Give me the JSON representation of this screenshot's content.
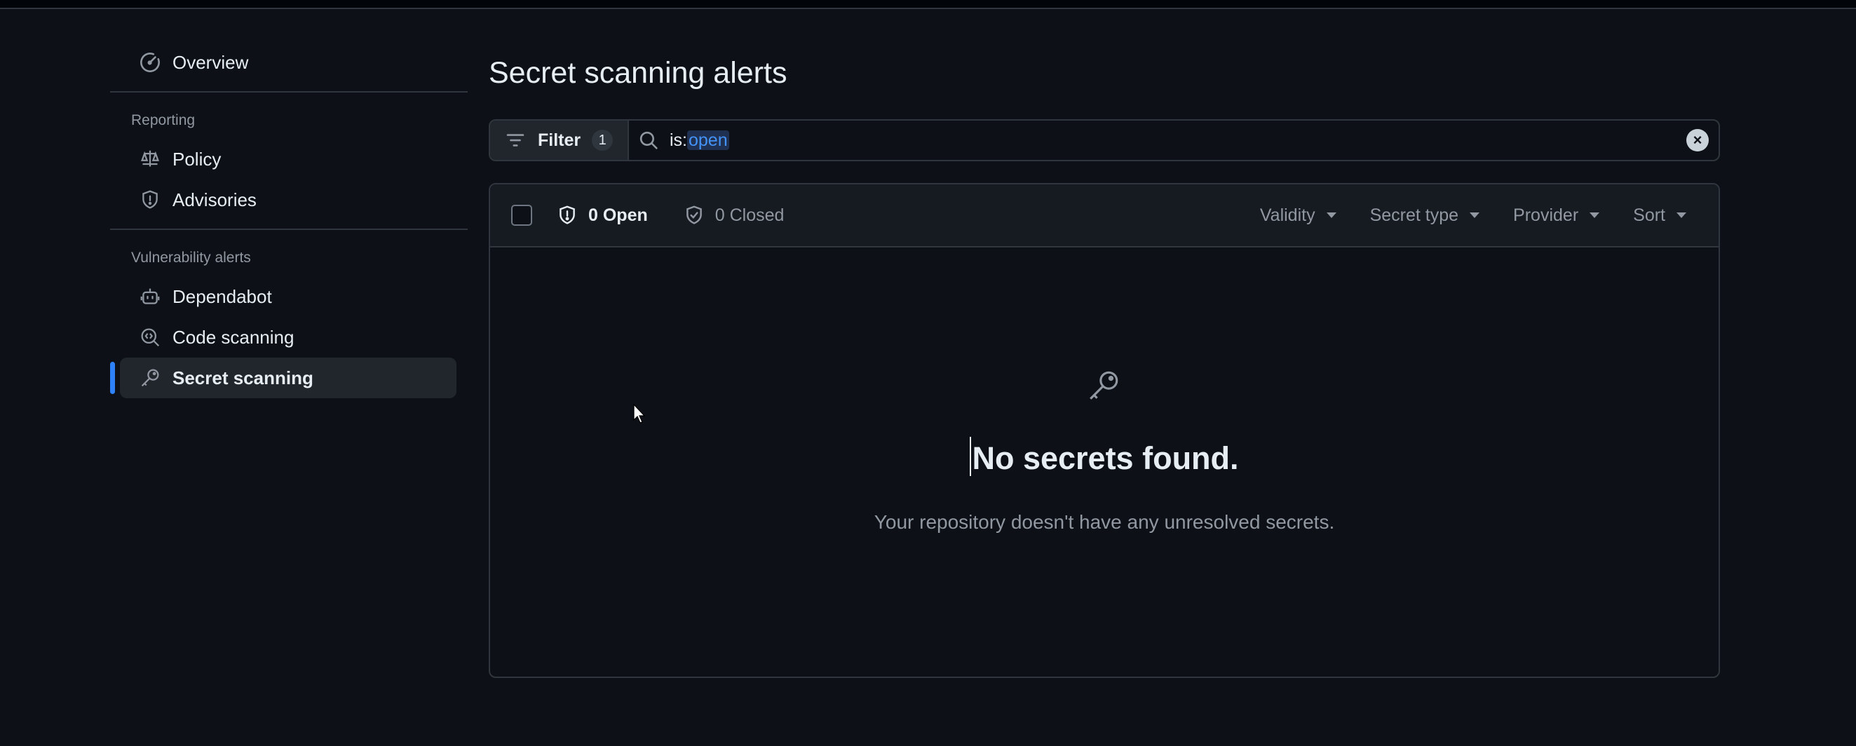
{
  "sidebar": {
    "overview": "Overview",
    "reporting_heading": "Reporting",
    "reporting_items": [
      {
        "label": "Policy",
        "icon": "law-icon"
      },
      {
        "label": "Advisories",
        "icon": "shield-icon"
      }
    ],
    "vuln_heading": "Vulnerability alerts",
    "vuln_items": [
      {
        "label": "Dependabot",
        "icon": "dependabot-icon"
      },
      {
        "label": "Code scanning",
        "icon": "codescan-icon"
      },
      {
        "label": "Secret scanning",
        "icon": "key-icon",
        "active": true
      }
    ]
  },
  "main": {
    "title": "Secret scanning alerts",
    "filter": {
      "label": "Filter",
      "count": "1"
    },
    "search": {
      "prefix": "is:",
      "qualifier": "open"
    },
    "states": {
      "open": "0 Open",
      "closed": "0 Closed"
    },
    "dropdowns": [
      "Validity",
      "Secret type",
      "Provider",
      "Sort"
    ],
    "blankslate": {
      "title": "No secrets found.",
      "description": "Your repository doesn't have any unresolved secrets."
    }
  },
  "colors": {
    "background": "#0d1117",
    "accent": "#2f81f7",
    "border": "#30363d",
    "muted_text": "#9198a1"
  }
}
